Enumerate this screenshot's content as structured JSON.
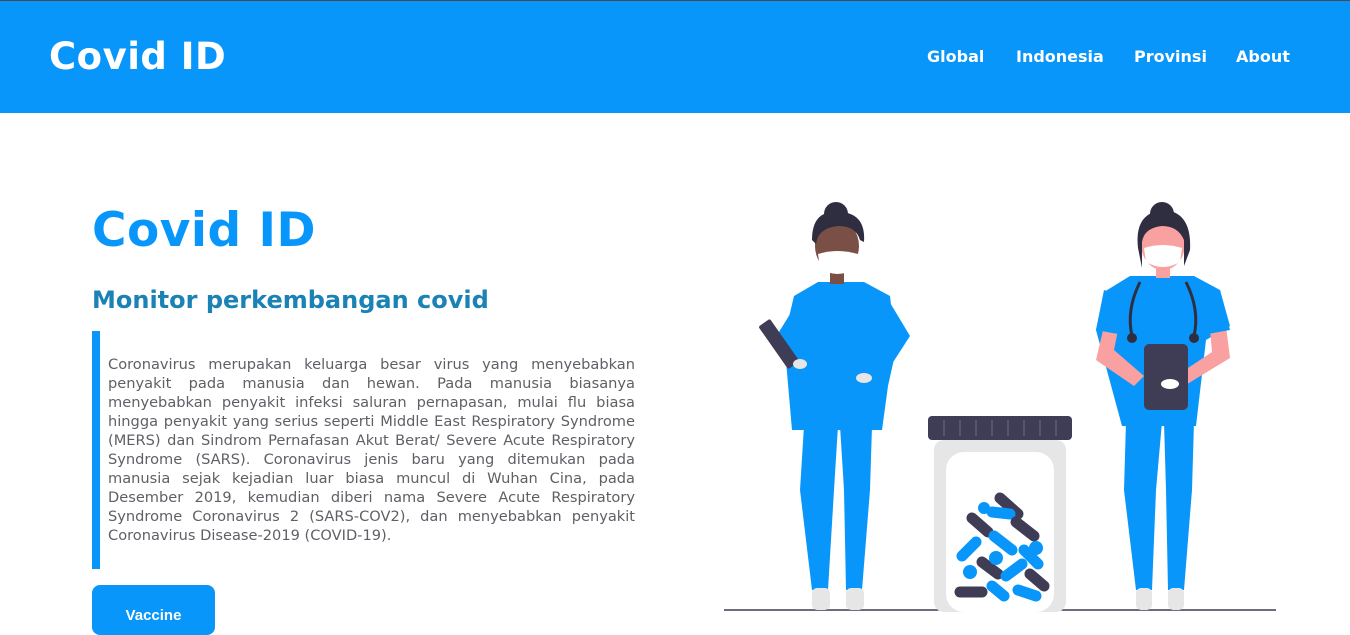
{
  "navbar": {
    "brand": "Covid ID",
    "links": [
      "Global",
      "Indonesia",
      "Provinsi",
      "About"
    ]
  },
  "hero": {
    "title": "Covid ID",
    "subtitle": "Monitor perkembangan covid",
    "description": "Coronavirus merupakan keluarga besar virus yang menyebabkan penyakit pada manusia dan hewan. Pada manusia biasanya menyebabkan penyakit infeksi saluran pernapasan, mulai flu biasa hingga penyakit yang serius seperti Middle East Respiratory Syndrome (MERS) dan Sindrom Pernafasan Akut Berat/ Severe Acute Respiratory Syndrome (SARS). Coronavirus jenis baru yang ditemukan pada manusia sejak kejadian luar biasa muncul di Wuhan Cina, pada Desember 2019, kemudian diberi nama Severe Acute Respiratory Syndrome Coronavirus 2 (SARS-COV2), dan menyebabkan penyakit Coronavirus Disease-2019 (COVID-19).",
    "button_label": "Vaccine"
  },
  "colors": {
    "primary": "#0996fa",
    "subtitle": "#1a82b5",
    "body_text": "#5f5f66"
  },
  "illustration": {
    "icon": "medical-staff-illustration"
  }
}
